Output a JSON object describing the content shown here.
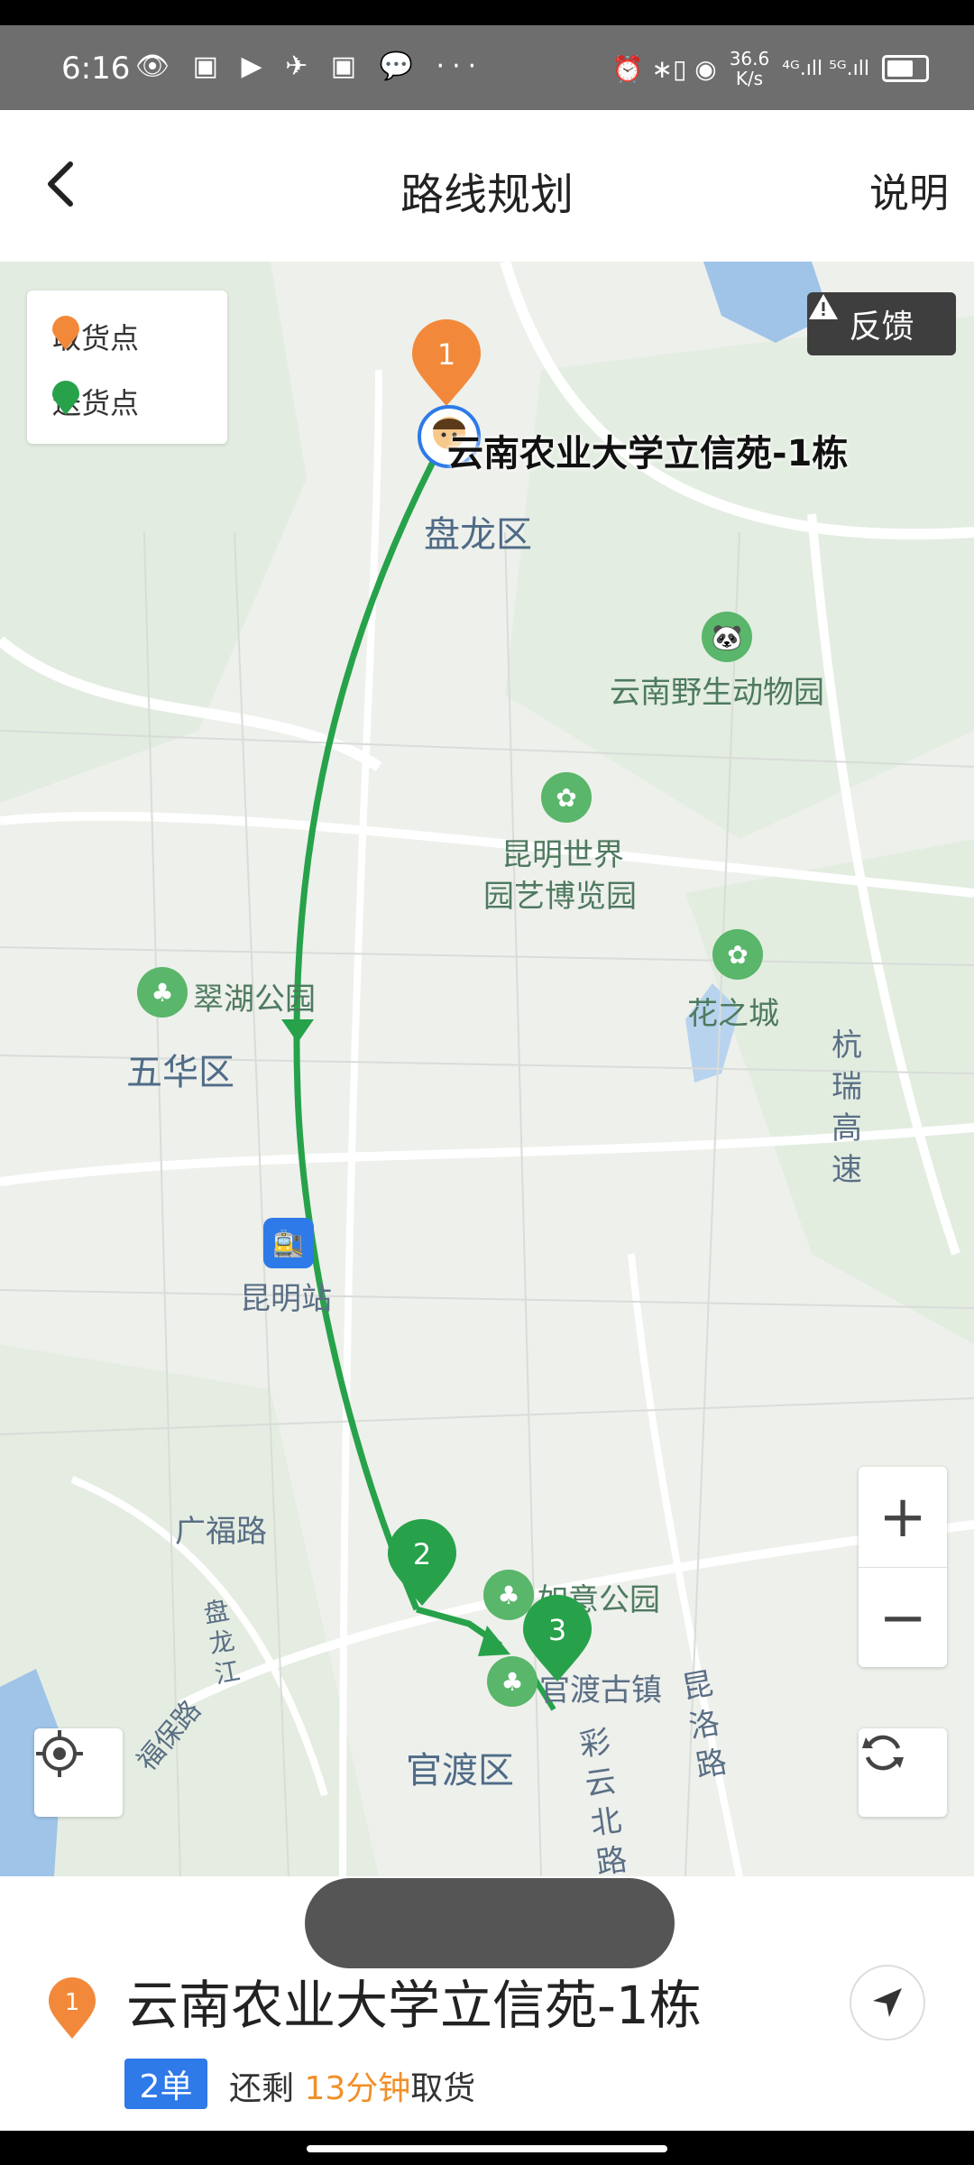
{
  "status_bar": {
    "time": "6:16",
    "left_icons": "👁 ▣ ▶ ✈ ▣ 💬 ···",
    "right_icons": "⏰ ∗▯ ◉",
    "speed": "36.6",
    "speed_unit": "K/s",
    "signal": "⁴ᴳ.ıll ⁵ᴳ.ıll"
  },
  "header": {
    "title": "路线规划",
    "explain": "说明"
  },
  "legend": {
    "pickup": "取货点",
    "dropoff": "送货点",
    "pickup_color": "#f2893a",
    "dropoff_color": "#27a24a"
  },
  "feedback": {
    "label": "反馈"
  },
  "markers": {
    "m1": "1",
    "m2": "2",
    "m3": "3"
  },
  "map_labels": {
    "pickup_name": "云南农业大学立信苑-1栋",
    "panlong": "盘龙区",
    "zoo": "云南野生动物园",
    "expo_line1": "昆明世界",
    "expo_line2": "园艺博览园",
    "flower": "花之城",
    "cuihu": "翠湖公园",
    "wuhua": "五华区",
    "expressway": "杭瑞高速",
    "station": "昆明站",
    "guangfu": "广福路",
    "fubao": "福保路",
    "panlongjiang": "盘龙江",
    "ruyi": "如意公园",
    "guandu_town": "官渡古镇",
    "kunluo": "昆洛路",
    "caiyun": "彩云北路",
    "guandu": "官渡区"
  },
  "zoom": {
    "plus": "+",
    "minus": "−"
  },
  "bottom": {
    "marker": "1",
    "address": "云南农业大学立信苑-1栋",
    "orders": "2单",
    "remain_prefix": "还剩",
    "remain_time": "13分钟",
    "remain_suffix": "取货"
  },
  "colors": {
    "route": "#27a24a",
    "accent": "#f2893a",
    "blue": "#2e7ae8"
  }
}
